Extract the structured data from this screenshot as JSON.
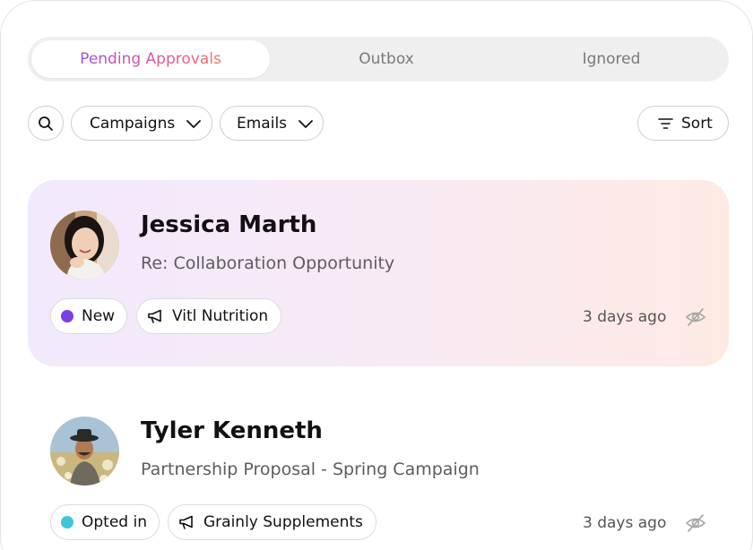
{
  "tabs": [
    {
      "label": "Pending Approvals",
      "active": true
    },
    {
      "label": "Outbox",
      "active": false
    },
    {
      "label": "Ignored",
      "active": false
    }
  ],
  "filters": {
    "search_icon": "search-icon",
    "campaigns_label": "Campaigns",
    "emails_label": "Emails",
    "sort_label": "Sort"
  },
  "items": [
    {
      "name": "Jessica Marth",
      "subject": "Re: Collaboration Opportunity",
      "status": "New",
      "status_color": "#7b3fe4",
      "campaign": "Vitl Nutrition",
      "time": "3 days ago",
      "highlighted": true
    },
    {
      "name": "Tyler Kenneth",
      "subject": "Partnership Proposal - Spring Campaign",
      "status": "Opted in",
      "status_color": "#3ec6d8",
      "campaign": "Grainly Supplements",
      "time": "3 days ago",
      "highlighted": false
    }
  ],
  "colors": {
    "accent_gradient_start": "#a050dc",
    "accent_gradient_end": "#f2746a",
    "card_highlight_start": "#f1e9fc",
    "card_highlight_end": "#ffeae3"
  }
}
